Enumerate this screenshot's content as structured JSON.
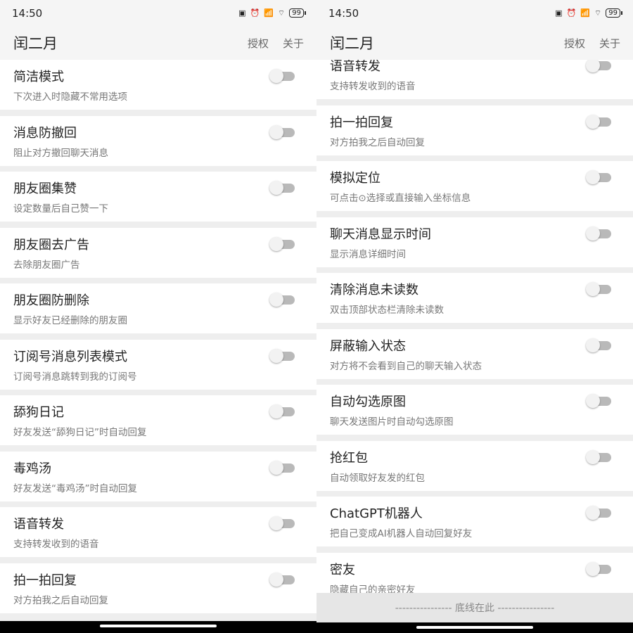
{
  "status": {
    "time": "14:50",
    "battery": "99"
  },
  "app": {
    "title": "闰二月",
    "actions": [
      "授权",
      "关于"
    ]
  },
  "left_items": [
    {
      "title": "简洁模式",
      "desc": "下次进入时隐藏不常用选项"
    },
    {
      "title": "消息防撤回",
      "desc": "阻止对方撤回聊天消息"
    },
    {
      "title": "朋友圈集赞",
      "desc": "设定数量后自己赞一下"
    },
    {
      "title": "朋友圈去广告",
      "desc": "去除朋友圈广告"
    },
    {
      "title": "朋友圈防删除",
      "desc": "显示好友已经删除的朋友圈"
    },
    {
      "title": "订阅号消息列表模式",
      "desc": "订阅号消息跳转到我的订阅号"
    },
    {
      "title": "舔狗日记",
      "desc": "好友发送“舔狗日记”时自动回复"
    },
    {
      "title": "毒鸡汤",
      "desc": "好友发送“毒鸡汤”时自动回复"
    },
    {
      "title": "语音转发",
      "desc": "支持转发收到的语音"
    },
    {
      "title": "拍一拍回复",
      "desc": "对方拍我之后自动回复"
    }
  ],
  "right_items": [
    {
      "title": "语音转发",
      "desc": "支持转发收到的语音"
    },
    {
      "title": "拍一拍回复",
      "desc": "对方拍我之后自动回复"
    },
    {
      "title": "模拟定位",
      "desc": "可点击⊙选择或直接输入坐标信息"
    },
    {
      "title": "聊天消息显示时间",
      "desc": "显示消息详细时间"
    },
    {
      "title": "清除消息未读数",
      "desc": "双击顶部状态栏清除未读数"
    },
    {
      "title": "屏蔽输入状态",
      "desc": "对方将不会看到自己的聊天输入状态"
    },
    {
      "title": "自动勾选原图",
      "desc": "聊天发送图片时自动勾选原图"
    },
    {
      "title": "抢红包",
      "desc": "自动领取好友发的红包"
    },
    {
      "title": "ChatGPT机器人",
      "desc": "把自己变成AI机器人自动回复好友"
    },
    {
      "title": "密友",
      "desc": "隐藏自己的亲密好友"
    }
  ],
  "footer_text": "---------------- 底线在此 ----------------",
  "icons": [
    "nfc-icon",
    "alarm-icon",
    "signal-icon",
    "wifi-icon",
    "battery-icon",
    "toggle-switch-icon"
  ]
}
